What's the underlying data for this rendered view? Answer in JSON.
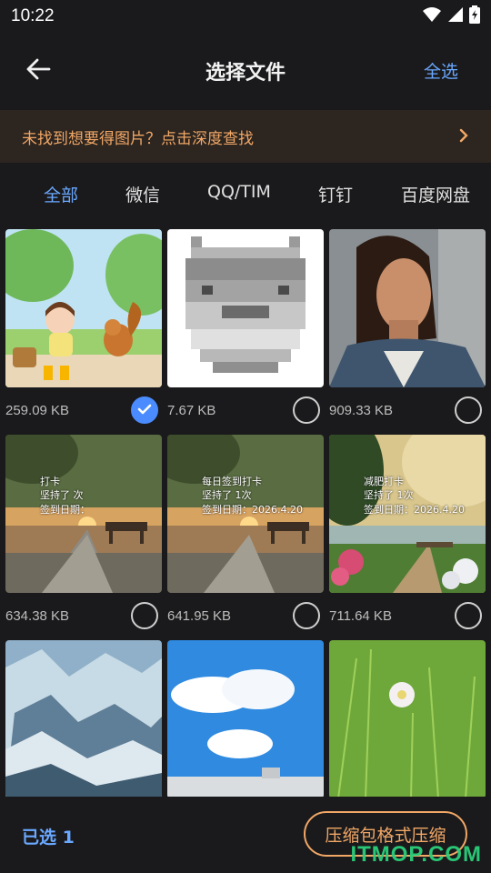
{
  "status_bar": {
    "time": "10:22",
    "icons": [
      "wifi-icon",
      "signal-icon",
      "battery-icon"
    ]
  },
  "app_bar": {
    "title": "选择文件",
    "select_all": "全选",
    "back_icon": "arrow-left-icon"
  },
  "banner": {
    "text": "未找到想要得图片？点击深度查找",
    "icon": "chevron-right-icon"
  },
  "tabs": [
    {
      "label": "全部",
      "active": true
    },
    {
      "label": "微信",
      "active": false
    },
    {
      "label": "QQ/TIM",
      "active": false
    },
    {
      "label": "钉钉",
      "active": false
    },
    {
      "label": "百度网盘",
      "active": false
    }
  ],
  "grid": [
    {
      "size": "259.09 KB",
      "checked": true,
      "image": "cartoon girl and squirrel picnic"
    },
    {
      "size": "7.67 KB",
      "checked": false,
      "image": "pixelated gray cat"
    },
    {
      "size": "909.33 KB",
      "checked": false,
      "image": "woman portrait"
    },
    {
      "size": "634.38 KB",
      "checked": false,
      "image": "lakeside sunset bench",
      "overlay": [
        "打卡",
        "坚持了    次",
        "签到日期："
      ]
    },
    {
      "size": "641.95 KB",
      "checked": false,
      "image": "lakeside sunset bench",
      "overlay": [
        "每日签到打卡",
        "坚持了    1次",
        "签到日期：2026.4.20"
      ]
    },
    {
      "size": "711.64 KB",
      "checked": false,
      "image": "forest lake flowers",
      "overlay": [
        "减肥打卡",
        "坚持了    1次",
        "签到日期：2026.4.20"
      ]
    },
    {
      "image": "glacier ice"
    },
    {
      "image": "blue sky clouds"
    },
    {
      "image": "green grass flower"
    }
  ],
  "bottom_bar": {
    "selected": "已选 1",
    "compress": "压缩包格式压缩"
  },
  "watermark": "ITMOP.COM",
  "colors": {
    "accent": "#6aa8ff",
    "orange": "#f1a766",
    "background": "#1a1a1c",
    "check": "#4a8cff"
  }
}
